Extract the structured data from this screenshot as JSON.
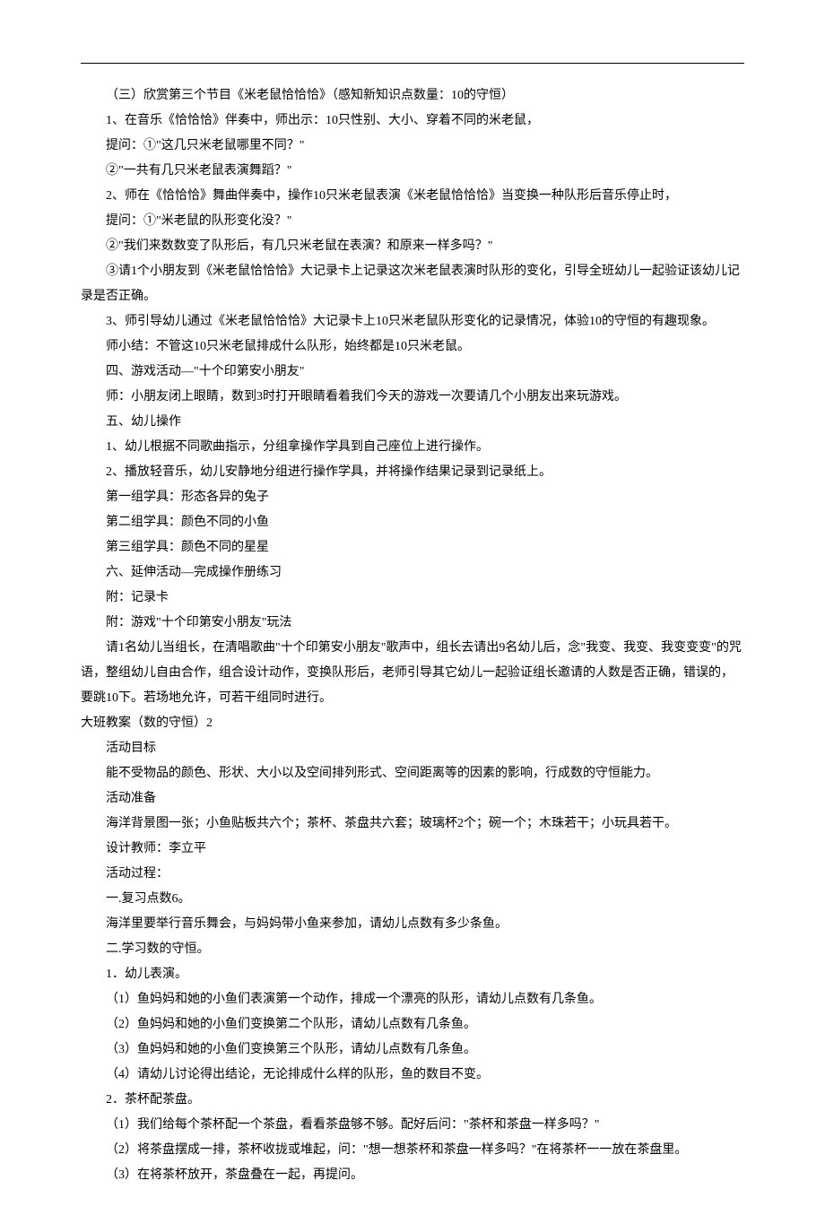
{
  "lines": [
    {
      "indent": true,
      "text": "（三）欣赏第三个节目《米老鼠恰恰恰》（感知新知识点数量：10的守恒）"
    },
    {
      "indent": true,
      "text": "1、在音乐《恰恰恰》伴奏中，师出示：10只性别、大小、穿着不同的米老鼠，"
    },
    {
      "indent": true,
      "text": "提问：①\"这几只米老鼠哪里不同？\""
    },
    {
      "indent": true,
      "text": "②\"一共有几只米老鼠表演舞蹈？\""
    },
    {
      "indent": true,
      "text": "2、师在《恰恰恰》舞曲伴奏中，操作10只米老鼠表演《米老鼠恰恰恰》当变换一种队形后音乐停止时，"
    },
    {
      "indent": true,
      "text": "提问：①\"米老鼠的队形变化没？\""
    },
    {
      "indent": true,
      "text": "②\"我们来数数变了队形后，有几只米老鼠在表演？和原来一样多吗？\""
    },
    {
      "indent": true,
      "text": "③请1个小朋友到《米老鼠恰恰恰》大记录卡上记录这次米老鼠表演时队形的变化，引导全班幼儿一起验证该幼儿记录是否正确。"
    },
    {
      "indent": true,
      "text": "3、师引导幼儿通过《米老鼠恰恰恰》大记录卡上10只米老鼠队形变化的记录情况，体验10的守恒的有趣现象。"
    },
    {
      "indent": true,
      "text": "师小结：不管这10只米老鼠排成什么队形，始终都是10只米老鼠。"
    },
    {
      "indent": true,
      "text": "四、游戏活动—\"十个印第安小朋友\""
    },
    {
      "indent": true,
      "text": "师：小朋友闭上眼睛，数到3时打开眼睛看着我们今天的游戏一次要请几个小朋友出来玩游戏。"
    },
    {
      "indent": true,
      "text": "五、幼儿操作"
    },
    {
      "indent": true,
      "text": "1、幼儿根据不同歌曲指示，分组拿操作学具到自己座位上进行操作。"
    },
    {
      "indent": true,
      "text": "2、播放轻音乐，幼儿安静地分组进行操作学具，并将操作结果记录到记录纸上。"
    },
    {
      "indent": true,
      "text": "第一组学具：形态各异的兔子"
    },
    {
      "indent": true,
      "text": "第二组学具：颜色不同的小鱼"
    },
    {
      "indent": true,
      "text": "第三组学具：颜色不同的星星"
    },
    {
      "indent": true,
      "text": "六、延伸活动—完成操作册练习"
    },
    {
      "indent": true,
      "text": "附：记录卡"
    },
    {
      "indent": true,
      "text": "附：游戏\"十个印第安小朋友\"玩法"
    },
    {
      "indent": true,
      "text": "请1名幼儿当组长，在清唱歌曲\"十个印第安小朋友\"歌声中，组长去请出9名幼儿后，念\"我变、我变、我变变变\"的咒语，整组幼儿自由合作，组合设计动作，变换队形后，老师引导其它幼儿一起验证组长邀请的人数是否正确，错误的，要跳10下。若场地允许，可若干组同时进行。"
    },
    {
      "indent": false,
      "text": "大班教案（数的守恒）2"
    },
    {
      "indent": true,
      "text": "活动目标"
    },
    {
      "indent": true,
      "text": "能不受物品的颜色、形状、大小以及空间排列形式、空间距离等的因素的影响，行成数的守恒能力。"
    },
    {
      "indent": true,
      "text": "活动准备"
    },
    {
      "indent": true,
      "text": "海洋背景图一张；小鱼贴板共六个；茶杯、茶盘共六套；玻璃杯2个；碗一个；木珠若干；小玩具若干。"
    },
    {
      "indent": true,
      "text": "设计教师：李立平"
    },
    {
      "indent": true,
      "text": "活动过程："
    },
    {
      "indent": true,
      "text": "一.复习点数6。"
    },
    {
      "indent": true,
      "text": "海洋里要举行音乐舞会，与妈妈带小鱼来参加，请幼儿点数有多少条鱼。"
    },
    {
      "indent": true,
      "text": "二.学习数的守恒。"
    },
    {
      "indent": true,
      "text": "1．幼儿表演。"
    },
    {
      "indent": true,
      "text": "（1）鱼妈妈和她的小鱼们表演第一个动作，排成一个漂亮的队形，请幼儿点数有几条鱼。"
    },
    {
      "indent": true,
      "text": "（2）鱼妈妈和她的小鱼们变换第二个队形，请幼儿点数有几条鱼。"
    },
    {
      "indent": true,
      "text": "（3）鱼妈妈和她的小鱼们变换第三个队形，请幼儿点数有几条鱼。"
    },
    {
      "indent": true,
      "text": "（4）请幼儿讨论得出结论，无论排成什么样的队形，鱼的数目不变。"
    },
    {
      "indent": true,
      "text": "2．茶杯配茶盘。"
    },
    {
      "indent": true,
      "text": "（1）我们给每个茶杯配一个茶盘，看看茶盘够不够。配好后问：\"茶杯和茶盘一样多吗？\""
    },
    {
      "indent": true,
      "text": "（2）将茶盘摆成一排，茶杯收拢或堆起，问：\"想一想茶杯和茶盘一样多吗？\"在将茶杯一一放在茶盘里。"
    },
    {
      "indent": true,
      "text": "（3）在将茶杯放开，茶盘叠在一起，再提问。"
    }
  ]
}
